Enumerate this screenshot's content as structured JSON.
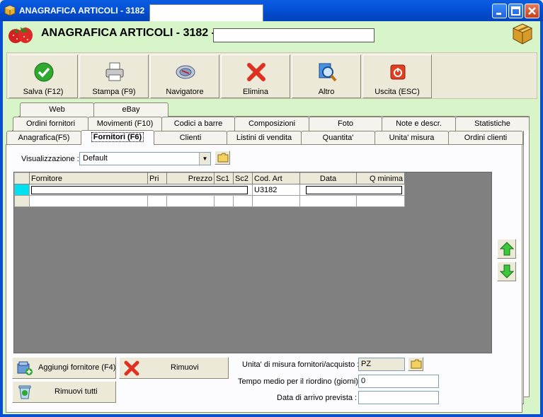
{
  "window": {
    "title": "ANAGRAFICA ARTICOLI - 3182"
  },
  "header": {
    "title": "ANAGRAFICA ARTICOLI - 3182 -"
  },
  "toolbar": [
    {
      "label": "Salva (F12)",
      "icon": "check-icon"
    },
    {
      "label": "Stampa (F9)",
      "icon": "printer-icon"
    },
    {
      "label": "Navigatore",
      "icon": "navigator-icon"
    },
    {
      "label": "Elimina",
      "icon": "delete-x-icon"
    },
    {
      "label": "Altro",
      "icon": "search-icon"
    },
    {
      "label": "Uscita (ESC)",
      "icon": "power-icon"
    }
  ],
  "tabs": {
    "row1": [
      "Web",
      "eBay"
    ],
    "row2": [
      "Ordini fornitori",
      "Movimenti (F10)",
      "Codici a barre",
      "Composizioni",
      "Foto",
      "Note e descr.",
      "Statistiche"
    ],
    "row3": [
      "Anagrafica(F5)",
      "Fornitori (F6)",
      "Clienti",
      "Listini di vendita",
      "Quantita'",
      "Unita' misura",
      "Ordini clienti"
    ],
    "active": "Fornitori (F6)"
  },
  "view": {
    "label": "Visualizzazione :",
    "value": "Default"
  },
  "grid": {
    "columns": [
      "Fornitore",
      "Pri",
      "Prezzo",
      "Sc1",
      "Sc2",
      "Cod. Art",
      "Data",
      "Q minima"
    ],
    "rows": [
      {
        "fornitore": "",
        "pri": "",
        "prezzo": "",
        "sc1": "",
        "sc2": "",
        "cod_art": "U3182",
        "data": "",
        "q_minima": ""
      }
    ]
  },
  "buttons": {
    "add_supplier": "Aggiungi fornitore (F4)",
    "remove": "Rimuovi",
    "remove_all": "Rimuovi tutti"
  },
  "form": {
    "unit_label": "Unita' di misura fornitori/acquisto :",
    "unit_value": "PZ",
    "lead_time_label": "Tempo medio per il riordino (giorni) :",
    "lead_time_value": "0",
    "arrival_label": "Data di arrivo prevista :",
    "arrival_value": ""
  }
}
